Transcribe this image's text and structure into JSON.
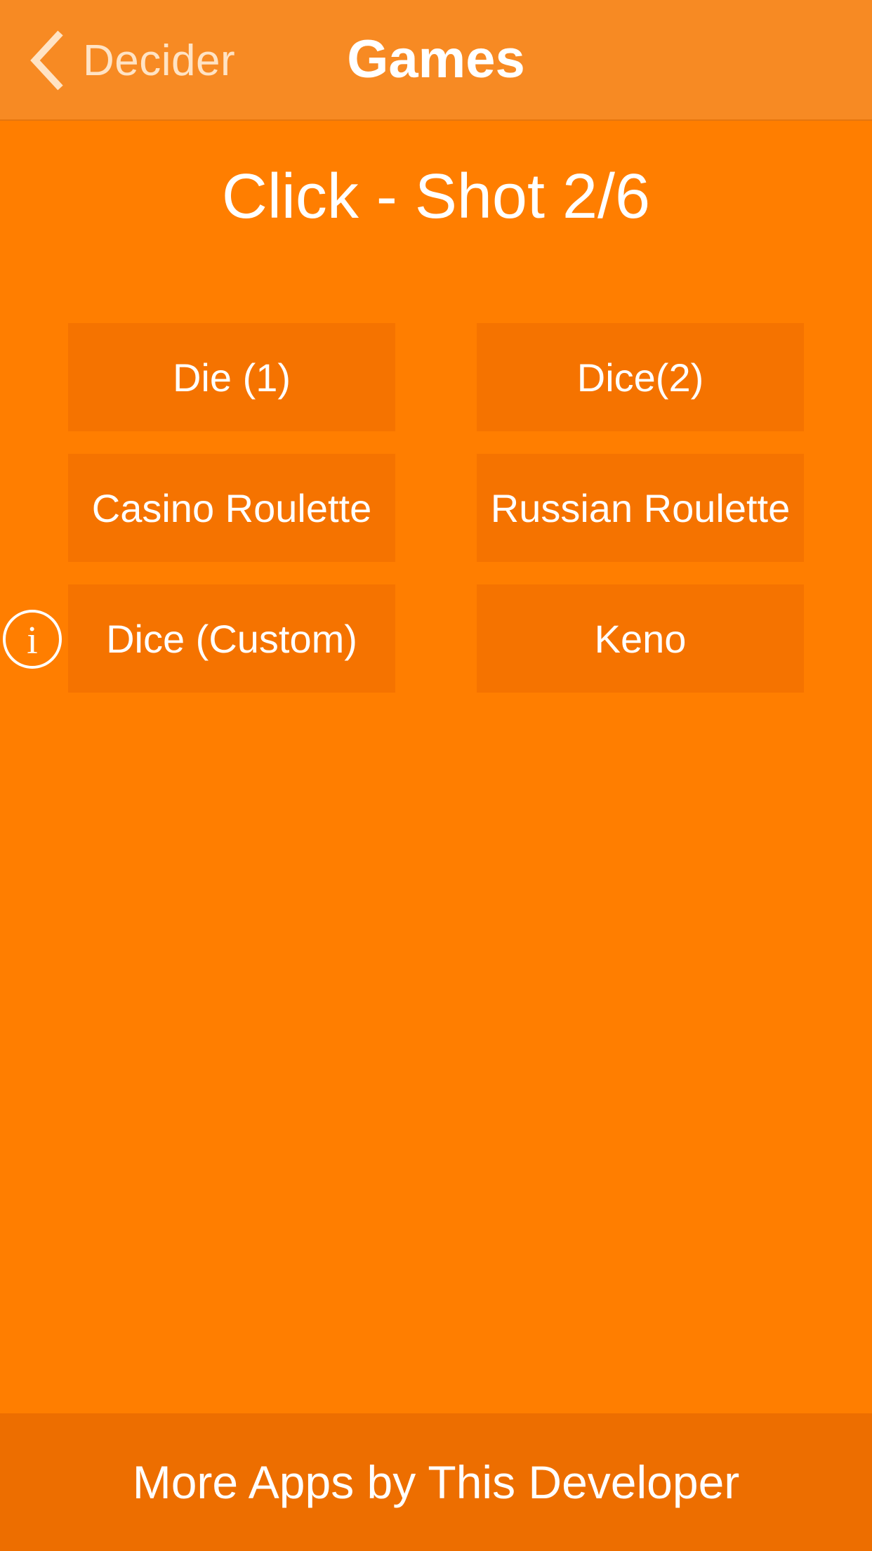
{
  "nav": {
    "back_label": "Decider",
    "back_icon": "chevron-left-icon",
    "title": "Games"
  },
  "page": {
    "heading": "Click - Shot 2/6"
  },
  "games": [
    {
      "label": "Die (1)"
    },
    {
      "label": "Dice(2)"
    },
    {
      "label": "Casino Roulette"
    },
    {
      "label": "Russian Roulette"
    },
    {
      "label": "Dice (Custom)"
    },
    {
      "label": "Keno"
    }
  ],
  "info": {
    "icon": "info-icon",
    "glyph": "i"
  },
  "footer": {
    "label": "More Apps by This Developer"
  },
  "colors": {
    "background": "#FF7E00",
    "navbar": "#F78A23",
    "button": "#F57300",
    "footer": "#ED6E00",
    "text": "#FFFFFF"
  }
}
